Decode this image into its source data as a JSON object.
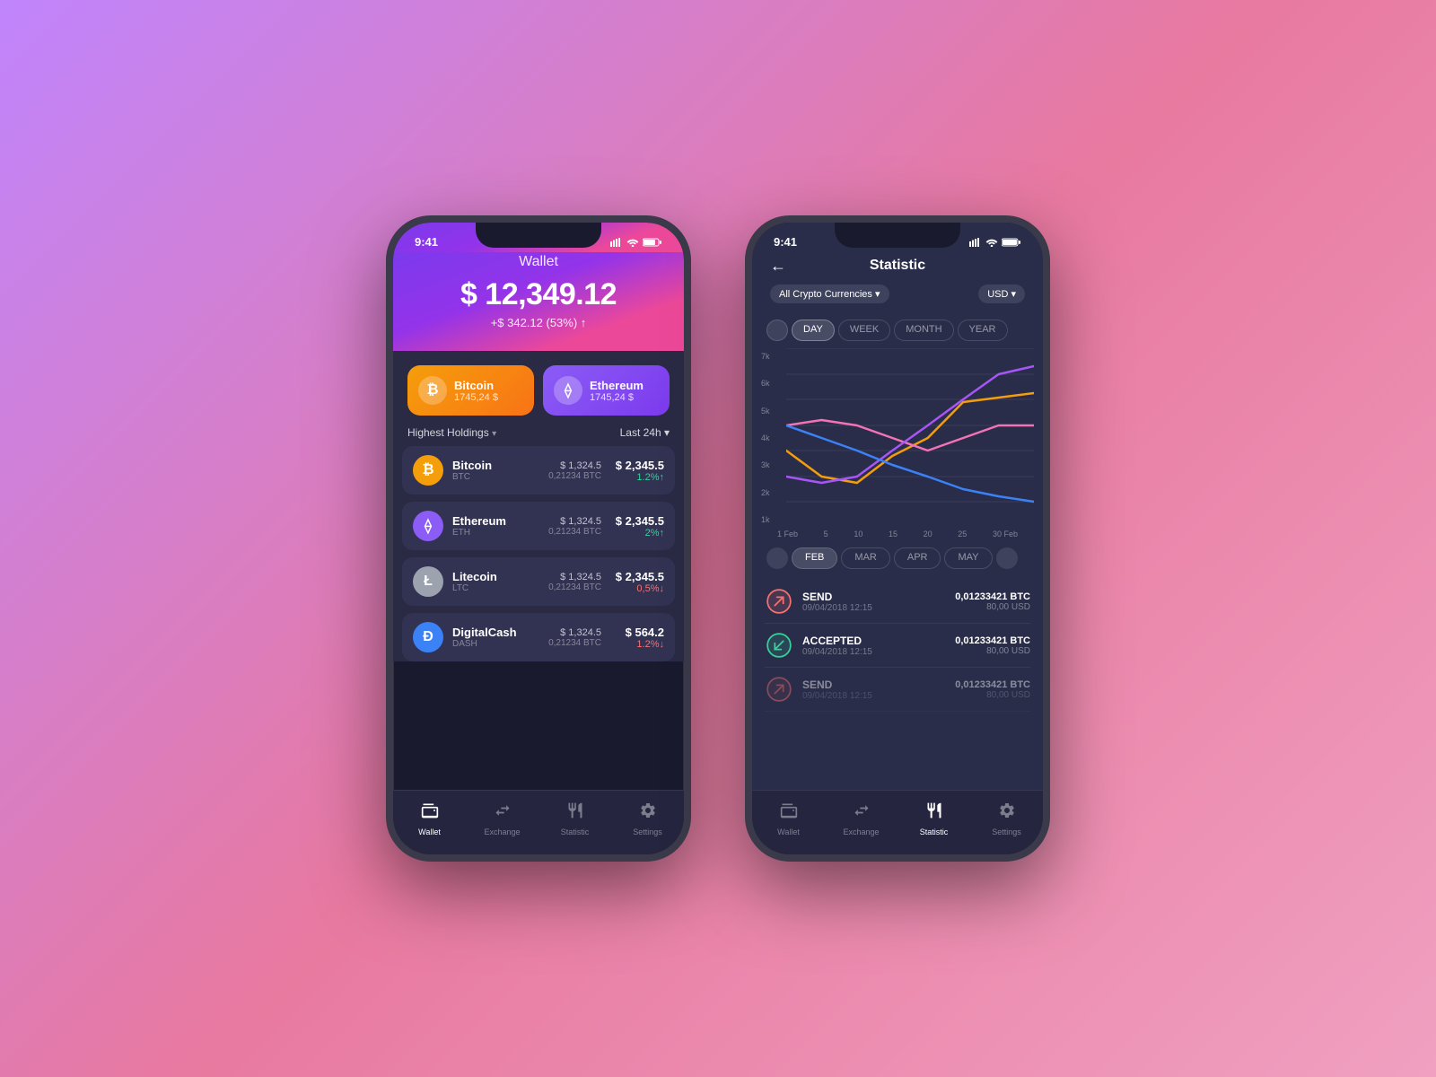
{
  "background": {
    "gradient": "linear-gradient(135deg, #c084fc, #e879a0, #f0a0c0)"
  },
  "phone1": {
    "statusBar": {
      "time": "9:41",
      "icons": "signal wifi battery"
    },
    "header": {
      "title": "Wallet",
      "amount": "$ 12,349.12",
      "change": "+$ 342.12 (53%) ↑"
    },
    "cards": [
      {
        "name": "Bitcoin",
        "value": "1745,24 $",
        "symbol": "₿",
        "color": "orange"
      },
      {
        "name": "Ethereum",
        "value": "1745,24 $",
        "symbol": "⟠",
        "color": "purple"
      }
    ],
    "holdingsLabel": "Highest Holdings ▾",
    "holdingsTime": "Last 24h ▾",
    "cryptos": [
      {
        "name": "Bitcoin",
        "sym": "BTC",
        "price": "$ 1,324.5",
        "sub": "0,21234 BTC",
        "total": "$ 2,345.5",
        "change": "1.2%↑",
        "up": true,
        "color": "#f59e0b"
      },
      {
        "name": "Ethereum",
        "sym": "ETH",
        "price": "$ 1,324.5",
        "sub": "0,21234 BTC",
        "total": "$ 2,345.5",
        "change": "2%↑",
        "up": true,
        "color": "#8b5cf6"
      },
      {
        "name": "Litecoin",
        "sym": "LTC",
        "price": "$ 1,324.5",
        "sub": "0,21234 BTC",
        "total": "$ 2,345.5",
        "change": "0,5%↓",
        "up": false,
        "color": "#e0e0e0"
      },
      {
        "name": "DigitalCash",
        "sym": "DASH",
        "price": "$ 1,324.5",
        "sub": "0,21234 BTC",
        "total": "$ 564.2",
        "change": "1.2%↓",
        "up": false,
        "color": "#3b82f6"
      }
    ],
    "nav": [
      {
        "label": "Wallet",
        "active": true,
        "icon": "👛"
      },
      {
        "label": "Exchange",
        "active": false,
        "icon": "⇄"
      },
      {
        "label": "Statistic",
        "active": false,
        "icon": "📊"
      },
      {
        "label": "Settings",
        "active": false,
        "icon": "⚙"
      }
    ]
  },
  "phone2": {
    "statusBar": {
      "time": "9:41",
      "icons": "signal wifi battery"
    },
    "header": {
      "title": "Statistic",
      "backLabel": "←"
    },
    "filter": {
      "currency": "All Crypto Currencies ▾",
      "unit": "USD ▾"
    },
    "periods": [
      "DAY",
      "WEEK",
      "MONTH",
      "YEAR"
    ],
    "activePeriod": "DAY",
    "chartYLabels": [
      "1k",
      "2k",
      "3k",
      "4k",
      "5k",
      "6k",
      "7k"
    ],
    "chartXLabels": [
      "1 Feb",
      "5",
      "10",
      "15",
      "20",
      "25",
      "30 Feb"
    ],
    "months": [
      "FEB",
      "MAR",
      "APR",
      "MAY"
    ],
    "activeMonth": "FEB",
    "transactions": [
      {
        "type": "SEND",
        "date": "09/04/2018 12:15",
        "btc": "0,01233421 BTC",
        "usd": "80,00 USD",
        "kind": "send"
      },
      {
        "type": "ACCEPTED",
        "date": "09/04/2018 12:15",
        "btc": "0,01233421 BTC",
        "usd": "80,00 USD",
        "kind": "accept"
      },
      {
        "type": "SEND",
        "date": "09/04/2018 12:15",
        "btc": "0,01233421 BTC",
        "usd": "80,00 USD",
        "kind": "send"
      }
    ],
    "nav": [
      {
        "label": "Wallet",
        "active": false,
        "icon": "👛"
      },
      {
        "label": "Exchange",
        "active": false,
        "icon": "⇄"
      },
      {
        "label": "Statistic",
        "active": true,
        "icon": "📊"
      },
      {
        "label": "Settings",
        "active": false,
        "icon": "⚙"
      }
    ]
  }
}
